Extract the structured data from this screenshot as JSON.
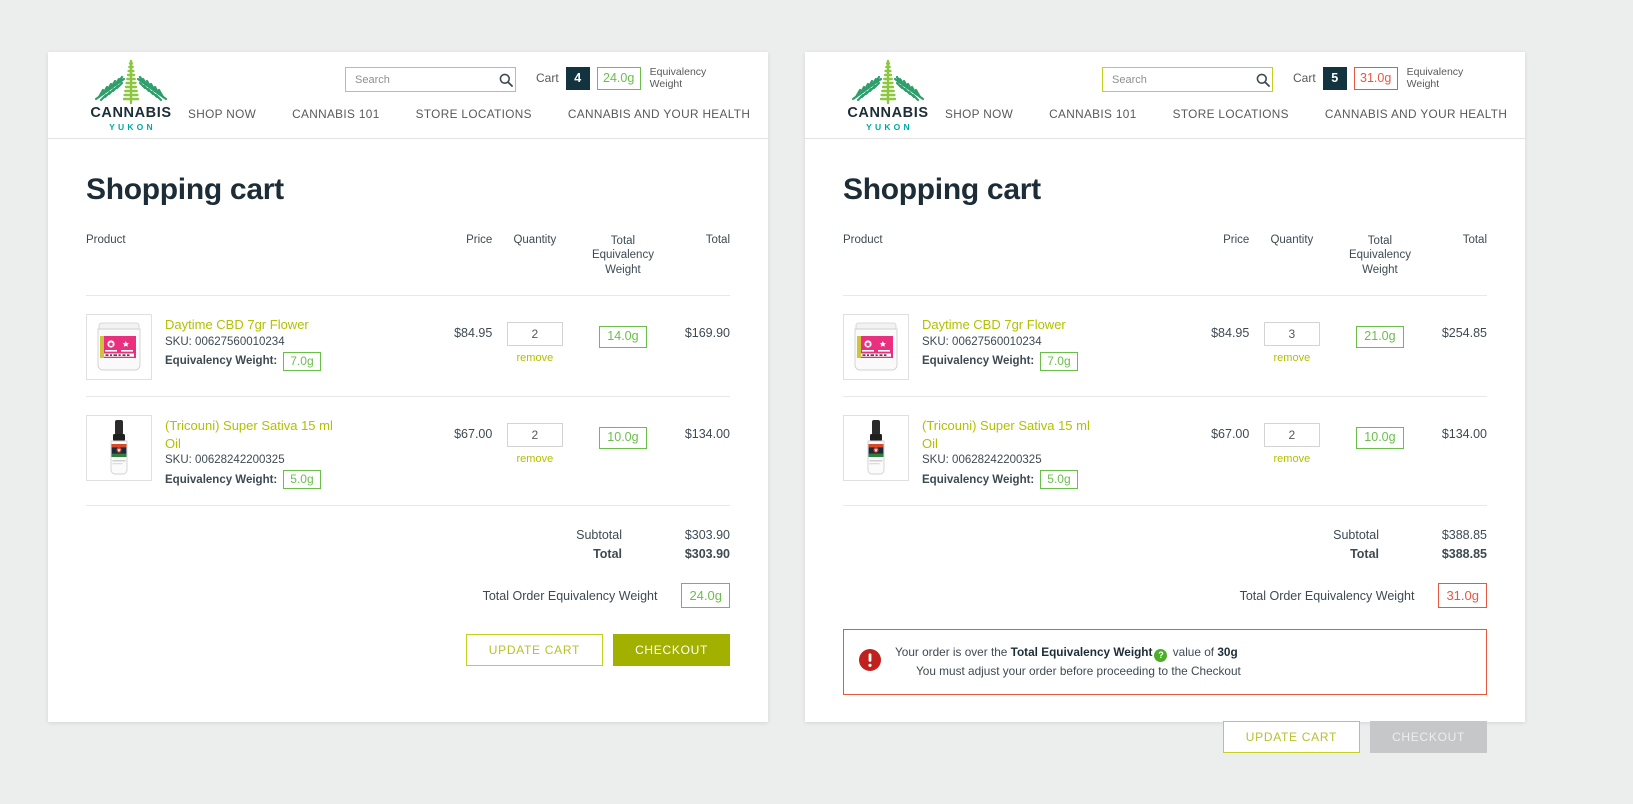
{
  "brand": {
    "name": "CANNABIS",
    "subtitle": "YUKON"
  },
  "panels": [
    {
      "id": "left",
      "header": {
        "search": {
          "placeholder": "Search",
          "value": "",
          "icon": "search-icon"
        },
        "cart_label": "Cart",
        "cart_count": "4",
        "equivalency_badge": "24.0g",
        "equivalency_over": false,
        "equivalency_caption_line1": "Equivalency",
        "equivalency_caption_line2": "Weight",
        "nav": [
          "SHOP NOW",
          "CANNABIS 101",
          "STORE LOCATIONS",
          "CANNABIS AND YOUR HEALTH"
        ]
      },
      "title": "Shopping cart",
      "columns": {
        "product": "Product",
        "price": "Price",
        "quantity": "Quantity",
        "total_eq_weight_line1": "Total",
        "total_eq_weight_line2": "Equivalency",
        "total_eq_weight_line3": "Weight",
        "total": "Total"
      },
      "items": [
        {
          "name": "Daytime CBD 7gr Flower",
          "sku_label": "SKU:",
          "sku": "00627560010234",
          "eqw_label": "Equivalency Weight:",
          "eqw": "7.0g",
          "price": "$84.95",
          "quantity": "2",
          "remove_label": "remove",
          "total_eq_weight": "14.0g",
          "total": "$169.90",
          "thumb": "jar-pink-label"
        },
        {
          "name": "(Tricouni) Super Sativa 15 ml Oil",
          "sku_label": "SKU:",
          "sku": "00628242200325",
          "eqw_label": "Equivalency Weight:",
          "eqw": "5.0g",
          "price": "$67.00",
          "quantity": "2",
          "remove_label": "remove",
          "total_eq_weight": "10.0g",
          "total": "$134.00",
          "thumb": "dropper-bottle"
        }
      ],
      "totals": {
        "subtotal_label": "Subtotal",
        "subtotal_value": "$303.90",
        "total_label": "Total",
        "total_value": "$303.90",
        "order_eqw_label": "Total Order Equivalency Weight",
        "order_eqw_value": "24.0g",
        "order_eqw_over": false
      },
      "warning": null,
      "actions": {
        "update_label": "UPDATE CART",
        "checkout_label": "CHECKOUT",
        "checkout_disabled": false
      }
    },
    {
      "id": "right",
      "header": {
        "search": {
          "placeholder": "Search",
          "value": "",
          "icon": "search-icon"
        },
        "cart_label": "Cart",
        "cart_count": "5",
        "equivalency_badge": "31.0g",
        "equivalency_over": true,
        "equivalency_caption_line1": "Equivalency",
        "equivalency_caption_line2": "Weight",
        "nav": [
          "SHOP NOW",
          "CANNABIS 101",
          "STORE LOCATIONS",
          "CANNABIS AND YOUR HEALTH"
        ]
      },
      "title": "Shopping cart",
      "columns": {
        "product": "Product",
        "price": "Price",
        "quantity": "Quantity",
        "total_eq_weight_line1": "Total",
        "total_eq_weight_line2": "Equivalency",
        "total_eq_weight_line3": "Weight",
        "total": "Total"
      },
      "items": [
        {
          "name": "Daytime CBD 7gr Flower",
          "sku_label": "SKU:",
          "sku": "00627560010234",
          "eqw_label": "Equivalency Weight:",
          "eqw": "7.0g",
          "price": "$84.95",
          "quantity": "3",
          "remove_label": "remove",
          "total_eq_weight": "21.0g",
          "total": "$254.85",
          "thumb": "jar-pink-label"
        },
        {
          "name": "(Tricouni) Super Sativa 15 ml Oil",
          "sku_label": "SKU:",
          "sku": "00628242200325",
          "eqw_label": "Equivalency Weight:",
          "eqw": "5.0g",
          "price": "$67.00",
          "quantity": "2",
          "remove_label": "remove",
          "total_eq_weight": "10.0g",
          "total": "$134.00",
          "thumb": "dropper-bottle"
        }
      ],
      "totals": {
        "subtotal_label": "Subtotal",
        "subtotal_value": "$388.85",
        "total_label": "Total",
        "total_value": "$388.85",
        "order_eqw_label": "Total Order Equivalency Weight",
        "order_eqw_value": "31.0g",
        "order_eqw_over": true
      },
      "warning": {
        "icon": "error-exclamation-icon",
        "line1_prefix": "Your order is over the ",
        "line1_bold": "Total Equivalency Weight",
        "line1_help_icon": "help-question-icon",
        "line1_mid": " value of ",
        "line1_bold2": "30g",
        "line2": "You must adjust your order before proceeding to the Checkout"
      },
      "actions": {
        "update_label": "UPDATE CART",
        "checkout_label": "CHECKOUT",
        "checkout_disabled": true
      }
    }
  ],
  "colors": {
    "brand_dark": "#1d2d37",
    "brand_teal": "#00a9a0",
    "accent_lime": "#c4cf20",
    "checkout_green": "#a2b000",
    "badge_green": "#6abf4b",
    "alert_red": "#e8573f",
    "cart_chip": "#13333f",
    "link_olive": "#b2c000",
    "page_bg": "#eceded",
    "disabled_gray": "#c5c7c9"
  }
}
